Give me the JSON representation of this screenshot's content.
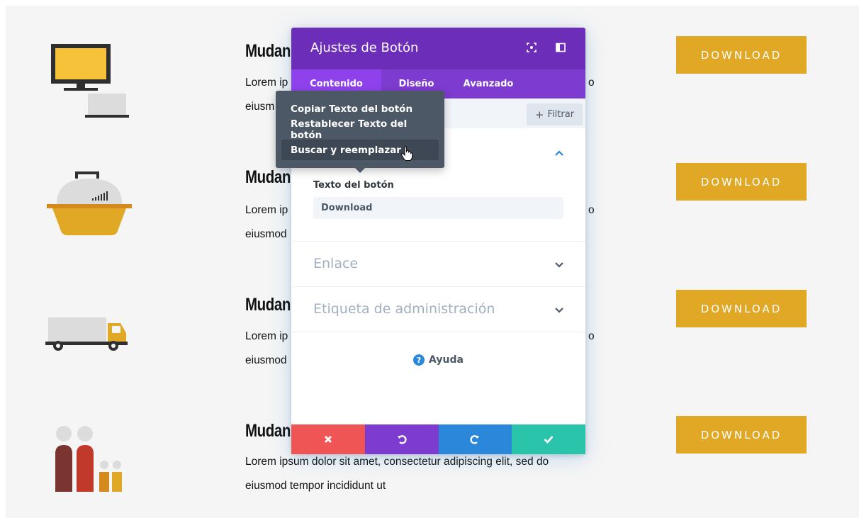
{
  "rows": [
    {
      "title": "Mudan",
      "text_line1": "Lorem ip",
      "text_line1_tail": "o",
      "text_line2": "eiusm",
      "button": "DOWNLOAD"
    },
    {
      "title": "Mudan",
      "text_line1": "Lorem ip",
      "text_line1_tail": "o",
      "text_line2": "eiusmod",
      "button": "DOWNLOAD"
    },
    {
      "title": "Mudan",
      "text_line1": "Lorem ip",
      "text_line1_tail": "o",
      "text_line2": "eiusmod",
      "button": "DOWNLOAD"
    },
    {
      "title": "Mudan",
      "text_line1": "Lorem ipsum dolor sit amet, consectetur adipiscing elit, sed do",
      "text_line1_tail": "",
      "text_line2": "eiusmod tempor incididunt ut",
      "button": "DOWNLOAD"
    }
  ],
  "row_icons": [
    "monitor-laptop-icon",
    "pet-carrier-icon",
    "moving-truck-icon",
    "family-icon"
  ],
  "colors": {
    "download": "#e0a825",
    "modal_header": "#6c2eb9",
    "tabs": "#7e3bd0",
    "tab_active": "#8f42ec",
    "cancel": "#ef5555",
    "undo": "#7e3bd0",
    "redo": "#2b87da",
    "save": "#29c4a9"
  },
  "modal": {
    "title": "Ajustes de Botón",
    "tabs": [
      {
        "label": "Contenido",
        "active": true
      },
      {
        "label": "Diseño",
        "active": false
      },
      {
        "label": "Avanzado",
        "active": false
      }
    ],
    "filter_label": "Filtrar",
    "text_section": {
      "field_label": "Texto del botón",
      "field_value": "Download"
    },
    "sections": [
      {
        "label": "Enlace"
      },
      {
        "label": "Etiqueta de administración"
      }
    ],
    "help_label": "Ayuda"
  },
  "context_menu": {
    "items": [
      {
        "label": "Copiar Texto del botón"
      },
      {
        "label": "Restablecer Texto del botón"
      },
      {
        "label": "Buscar y reemplazar",
        "hovered": true
      }
    ]
  }
}
